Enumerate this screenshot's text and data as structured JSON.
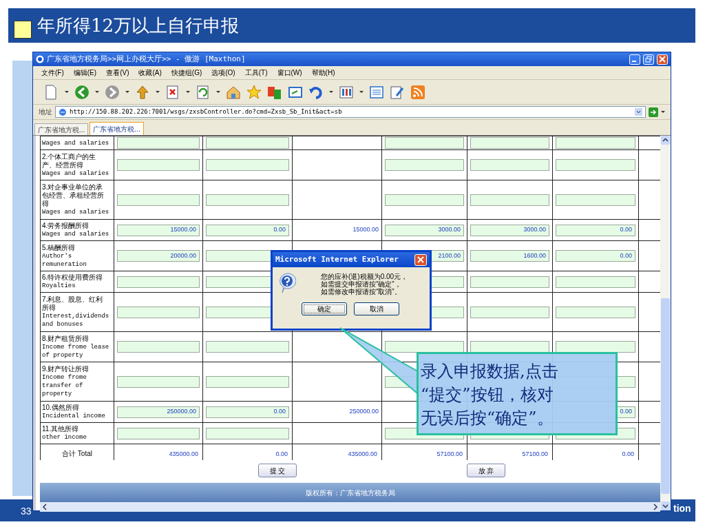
{
  "slide": {
    "title": "年所得12万以上自行申报",
    "page_number": "33",
    "footer_text": "tion"
  },
  "browser": {
    "title": "广东省地方税务局>>网上办税大厅>> - 傲游 [Maxthon]",
    "menu": [
      "文件(F)",
      "编辑(E)",
      "查看(V)",
      "收藏(A)",
      "快捷组(G)",
      "选项(O)",
      "工具(T)",
      "窗口(W)",
      "帮助(H)"
    ],
    "address_label": "地址",
    "url": "http://150.88.202.226:7001/wsgs/zxsbController.do?cmd=Zxsb_Sb_Init&act=sb",
    "tabs": [
      {
        "label": "广东省地方税...",
        "selected": false
      },
      {
        "label": "广东省地方税...",
        "selected": true
      }
    ]
  },
  "table": {
    "rows": [
      {
        "label_zh": [],
        "label_en": [
          "Wages and salaries"
        ],
        "cells": [
          {
            "kind": "input"
          },
          {
            "kind": "input"
          },
          {
            "kind": "empty"
          },
          {
            "kind": "input"
          },
          {
            "kind": "input"
          },
          {
            "kind": "input"
          }
        ]
      },
      {
        "label_zh": [
          "2.个体工商户的生",
          "产、经营所得"
        ],
        "label_en": [
          "Wages and salaries"
        ],
        "cells": [
          {
            "kind": "input"
          },
          {
            "kind": "input"
          },
          {
            "kind": "empty"
          },
          {
            "kind": "input"
          },
          {
            "kind": "input"
          },
          {
            "kind": "input"
          }
        ]
      },
      {
        "label_zh": [
          "3.对企事业单位的承",
          "包经营、承租经营所",
          "得"
        ],
        "label_en": [
          "Wages and salaries"
        ],
        "cells": [
          {
            "kind": "input"
          },
          {
            "kind": "input"
          },
          {
            "kind": "empty"
          },
          {
            "kind": "input"
          },
          {
            "kind": "input"
          },
          {
            "kind": "input"
          }
        ]
      },
      {
        "label_zh": [
          "4.劳务报酬所得"
        ],
        "label_en": [
          "Wages and salaries"
        ],
        "cells": [
          {
            "kind": "input",
            "value": "15000.00"
          },
          {
            "kind": "input",
            "value": "0.00"
          },
          {
            "kind": "text",
            "value": "15000.00"
          },
          {
            "kind": "input",
            "value": "3000.00"
          },
          {
            "kind": "input",
            "value": "3000.00"
          },
          {
            "kind": "input",
            "value": "0.00"
          }
        ]
      },
      {
        "label_zh": [
          "5.稿酬所得"
        ],
        "label_en": [
          "Author's",
          "remuneration"
        ],
        "cells": [
          {
            "kind": "input",
            "value": "20000.00"
          },
          {
            "kind": "input"
          },
          {
            "kind": "empty"
          },
          {
            "kind": "input",
            "value": "2100.00"
          },
          {
            "kind": "input",
            "value": "1600.00"
          },
          {
            "kind": "input",
            "value": "0.00"
          }
        ]
      },
      {
        "label_zh": [
          "6.特许权使用费所得"
        ],
        "label_en": [
          "Royalties"
        ],
        "cells": [
          {
            "kind": "input"
          },
          {
            "kind": "input"
          },
          {
            "kind": "empty"
          },
          {
            "kind": "input"
          },
          {
            "kind": "input"
          },
          {
            "kind": "input"
          }
        ]
      },
      {
        "label_zh": [
          "7.利息、股息、红利",
          "所得"
        ],
        "label_en": [
          "Interest,dividends",
          "and bonuses"
        ],
        "cells": [
          {
            "kind": "input"
          },
          {
            "kind": "input"
          },
          {
            "kind": "empty"
          },
          {
            "kind": "input"
          },
          {
            "kind": "input"
          },
          {
            "kind": "input"
          }
        ]
      },
      {
        "label_zh": [
          "8.财产租赁所得"
        ],
        "label_en": [
          "Income frome lease",
          "of property"
        ],
        "cells": [
          {
            "kind": "input"
          },
          {
            "kind": "input"
          },
          {
            "kind": "empty"
          },
          {
            "kind": "input"
          },
          {
            "kind": "input"
          },
          {
            "kind": "input"
          }
        ]
      },
      {
        "label_zh": [
          "9.财产转让所得"
        ],
        "label_en": [
          "Income frome",
          "transfer of",
          "property"
        ],
        "cells": [
          {
            "kind": "input"
          },
          {
            "kind": "input"
          },
          {
            "kind": "empty"
          },
          {
            "kind": "input"
          },
          {
            "kind": "empty"
          },
          {
            "kind": "input"
          }
        ]
      },
      {
        "label_zh": [
          "10.偶然所得"
        ],
        "label_en": [
          "Incidental income"
        ],
        "cells": [
          {
            "kind": "input",
            "value": "250000.00"
          },
          {
            "kind": "input",
            "value": "0.00"
          },
          {
            "kind": "text",
            "value": "250000.00"
          },
          {
            "kind": "empty"
          },
          {
            "kind": "empty"
          },
          {
            "kind": "input",
            "value": "0.00"
          }
        ]
      },
      {
        "label_zh": [
          "11.其他所得"
        ],
        "label_en": [
          "other income"
        ],
        "cells": [
          {
            "kind": "input"
          },
          {
            "kind": "input"
          },
          {
            "kind": "empty"
          },
          {
            "kind": "input"
          },
          {
            "kind": "input"
          },
          {
            "kind": "input"
          }
        ]
      }
    ],
    "total": {
      "label": "合计 Total",
      "values": [
        "435000.00",
        "0.00",
        "435000.00",
        "57100.00",
        "57100.00",
        "0.00"
      ]
    }
  },
  "form_buttons": [
    "提 交",
    "放 弃"
  ],
  "footer": "版权所有：广东省地方税务局",
  "dialog": {
    "title": "Microsoft Internet Explorer",
    "message": [
      "您的应补(退)税额为0.00元，",
      "如需提交申报请按“确定”，",
      "如需修改申报请按“取消”。"
    ],
    "buttons": [
      "确定",
      "取消"
    ]
  },
  "callout": {
    "lines": [
      "录入申报数据,点击",
      "“提交”按钮，核对",
      "无误后按“确定”。"
    ]
  }
}
